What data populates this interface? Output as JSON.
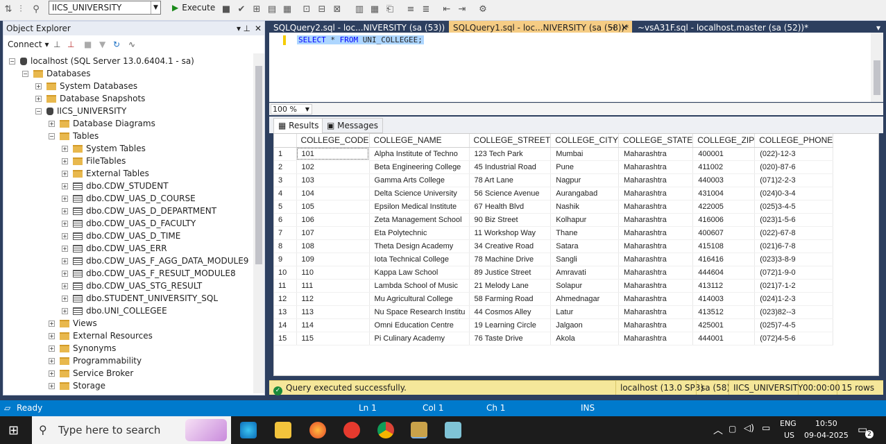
{
  "toolbar": {
    "database": "IICS_UNIVERSITY",
    "execute_label": "Execute"
  },
  "object_explorer": {
    "title": "Object Explorer",
    "connect_label": "Connect",
    "tree": [
      {
        "label": "localhost (SQL Server 13.0.6404.1 - sa)",
        "level": 0,
        "icon": "server-icon",
        "expanded": true
      },
      {
        "label": "Databases",
        "level": 1,
        "icon": "folder-icon",
        "expanded": true
      },
      {
        "label": "System Databases",
        "level": 2,
        "icon": "folder-icon",
        "expanded": false
      },
      {
        "label": "Database Snapshots",
        "level": 2,
        "icon": "folder-icon",
        "expanded": false
      },
      {
        "label": "IICS_UNIVERSITY",
        "level": 2,
        "icon": "database-icon",
        "expanded": true
      },
      {
        "label": "Database Diagrams",
        "level": 3,
        "icon": "folder-icon",
        "expanded": false
      },
      {
        "label": "Tables",
        "level": 3,
        "icon": "folder-icon",
        "expanded": true
      },
      {
        "label": "System Tables",
        "level": 4,
        "icon": "folder-icon",
        "expanded": false
      },
      {
        "label": "FileTables",
        "level": 4,
        "icon": "folder-icon",
        "expanded": false
      },
      {
        "label": "External Tables",
        "level": 4,
        "icon": "folder-icon",
        "expanded": false
      },
      {
        "label": "dbo.CDW_STUDENT",
        "level": 4,
        "icon": "table-icon",
        "expanded": false
      },
      {
        "label": "dbo.CDW_UAS_D_COURSE",
        "level": 4,
        "icon": "table-icon",
        "expanded": false
      },
      {
        "label": "dbo.CDW_UAS_D_DEPARTMENT",
        "level": 4,
        "icon": "table-icon",
        "expanded": false
      },
      {
        "label": "dbo.CDW_UAS_D_FACULTY",
        "level": 4,
        "icon": "table-icon",
        "expanded": false
      },
      {
        "label": "dbo.CDW_UAS_D_TIME",
        "level": 4,
        "icon": "table-icon",
        "expanded": false
      },
      {
        "label": "dbo.CDW_UAS_ERR",
        "level": 4,
        "icon": "table-icon",
        "expanded": false
      },
      {
        "label": "dbo.CDW_UAS_F_AGG_DATA_MODULE9",
        "level": 4,
        "icon": "table-icon",
        "expanded": false
      },
      {
        "label": "dbo.CDW_UAS_F_RESULT_MODULE8",
        "level": 4,
        "icon": "table-icon",
        "expanded": false
      },
      {
        "label": "dbo.CDW_UAS_STG_RESULT",
        "level": 4,
        "icon": "table-icon",
        "expanded": false
      },
      {
        "label": "dbo.STUDENT_UNIVERSITY_SQL",
        "level": 4,
        "icon": "table-icon",
        "expanded": false
      },
      {
        "label": "dbo.UNI_COLLEGEE",
        "level": 4,
        "icon": "table-icon",
        "expanded": false
      },
      {
        "label": "Views",
        "level": 3,
        "icon": "folder-icon",
        "expanded": false
      },
      {
        "label": "External Resources",
        "level": 3,
        "icon": "folder-icon",
        "expanded": false
      },
      {
        "label": "Synonyms",
        "level": 3,
        "icon": "folder-icon",
        "expanded": false
      },
      {
        "label": "Programmability",
        "level": 3,
        "icon": "folder-icon",
        "expanded": false
      },
      {
        "label": "Service Broker",
        "level": 3,
        "icon": "folder-icon",
        "expanded": false
      },
      {
        "label": "Storage",
        "level": 3,
        "icon": "folder-icon",
        "expanded": false
      }
    ]
  },
  "tabs": [
    {
      "label": "SQLQuery2.sql - loc...NIVERSITY (sa (53))",
      "active": false
    },
    {
      "label": "SQLQuery1.sql - loc...NIVERSITY (sa (58))*",
      "active": true
    },
    {
      "label": "~vsA31F.sql - localhost.master (sa (52))*",
      "active": false
    }
  ],
  "editor": {
    "query_kw1": "SELECT",
    "query_star": "*",
    "query_kw2": "FROM",
    "query_rest": "UNI_COLLEGEE;"
  },
  "zoom": "100 %",
  "result_tabs": {
    "results": "Results",
    "messages": "Messages"
  },
  "grid": {
    "columns": [
      "COLLEGE_CODE",
      "COLLEGE_NAME",
      "COLLEGE_STREET",
      "COLLEGE_CITY",
      "COLLEGE_STATE",
      "COLLEGE_ZIP",
      "COLLEGE_PHONE"
    ],
    "rows": [
      [
        "1",
        "101",
        "Alpha Institute of Techno",
        "123 Tech Park",
        "Mumbai",
        "Maharashtra",
        "400001",
        "(022)-12-3"
      ],
      [
        "2",
        "102",
        "Beta Engineering College",
        "45 Industrial Road",
        "Pune",
        "Maharashtra",
        "411002",
        "(020)-87-6"
      ],
      [
        "3",
        "103",
        "Gamma Arts College",
        "78 Art Lane",
        "Nagpur",
        "Maharashtra",
        "440003",
        "(071)2-2-3"
      ],
      [
        "4",
        "104",
        "Delta Science University",
        "56 Science Avenue",
        "Aurangabad",
        "Maharashtra",
        "431004",
        "(024)0-3-4"
      ],
      [
        "5",
        "105",
        "Epsilon Medical Institute",
        "67 Health Blvd",
        "Nashik",
        "Maharashtra",
        "422005",
        "(025)3-4-5"
      ],
      [
        "6",
        "106",
        "Zeta Management School",
        "90 Biz Street",
        "Kolhapur",
        "Maharashtra",
        "416006",
        "(023)1-5-6"
      ],
      [
        "7",
        "107",
        "Eta Polytechnic",
        "11 Workshop Way",
        "Thane",
        "Maharashtra",
        "400607",
        "(022)-67-8"
      ],
      [
        "8",
        "108",
        "Theta Design Academy",
        "34 Creative Road",
        "Satara",
        "Maharashtra",
        "415108",
        "(021)6-7-8"
      ],
      [
        "9",
        "109",
        "Iota Technical College",
        "78 Machine Drive",
        "Sangli",
        "Maharashtra",
        "416416",
        "(023)3-8-9"
      ],
      [
        "10",
        "110",
        "Kappa Law School",
        "89 Justice Street",
        "Amravati",
        "Maharashtra",
        "444604",
        "(072)1-9-0"
      ],
      [
        "11",
        "111",
        "Lambda School of Music",
        "21 Melody Lane",
        "Solapur",
        "Maharashtra",
        "413112",
        "(021)7-1-2"
      ],
      [
        "12",
        "112",
        "Mu Agricultural College",
        "58 Farming Road",
        "Ahmednagar",
        "Maharashtra",
        "414003",
        "(024)1-2-3"
      ],
      [
        "13",
        "113",
        "Nu Space Research Institu",
        "44 Cosmos Alley",
        "Latur",
        "Maharashtra",
        "413512",
        "(023)82--3"
      ],
      [
        "14",
        "114",
        "Omni Education Centre",
        "19 Learning Circle",
        "Jalgaon",
        "Maharashtra",
        "425001",
        "(025)7-4-5"
      ],
      [
        "15",
        "115",
        "Pi Culinary Academy",
        "76 Taste Drive",
        "Akola",
        "Maharashtra",
        "444001",
        "(072)4-5-6"
      ]
    ]
  },
  "query_status": {
    "message": "Query executed successfully.",
    "server": "localhost (13.0 SP3)",
    "user": "sa (58)",
    "database": "IICS_UNIVERSITY",
    "time": "00:00:00",
    "rows": "15 rows"
  },
  "app_status": {
    "ready": "Ready",
    "ln": "Ln 1",
    "col": "Col 1",
    "ch": "Ch 1",
    "ins": "INS"
  },
  "taskbar": {
    "search_placeholder": "Type here to search",
    "lang1": "ENG",
    "lang2": "US",
    "time": "10:50",
    "date": "09-04-2025",
    "notifications": "2"
  },
  "colors": {
    "accent": "#007acc",
    "tab_active": "#f5cc84",
    "status_bar": "#f5e79a",
    "titlebar": "#2d3f5f"
  }
}
